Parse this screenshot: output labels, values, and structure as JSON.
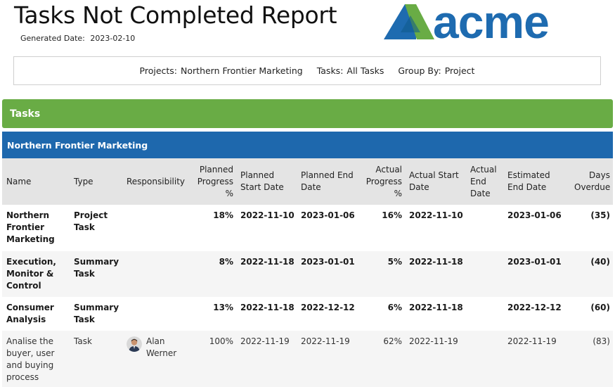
{
  "report": {
    "title": "Tasks Not Completed Report",
    "generated_label": "Generated Date:",
    "generated_value": "2023-02-10"
  },
  "logo": {
    "text": "acme",
    "colors": [
      "#1e6bb0",
      "#69ac45",
      "#0f5a8a"
    ]
  },
  "filters": {
    "projects_label": "Projects:",
    "projects_value": "Northern Frontier Marketing",
    "tasks_label": "Tasks:",
    "tasks_value": "All Tasks",
    "group_label": "Group By:",
    "group_value": "Project"
  },
  "section": {
    "title": "Tasks",
    "color": "#69ac45"
  },
  "group": {
    "title": "Northern Frontier Marketing",
    "color": "#1e68ad"
  },
  "columns": {
    "name": "Name",
    "type": "Type",
    "responsibility": "Responsibility",
    "planned_progress": "Planned Progress %",
    "planned_start": "Planned Start Date",
    "planned_end": "Planned End Date",
    "actual_progress": "Actual Progress %",
    "actual_start": "Actual Start Date",
    "actual_end": "Actual End Date",
    "estimated_end": "Estimated End Date",
    "days_overdue": "Days Overdue"
  },
  "rows": [
    {
      "name": "Northern Frontier Marketing",
      "type": "Project Task",
      "responsibility": "",
      "planned_progress": "18%",
      "planned_start": "2022-11-10",
      "planned_end": "2023-01-06",
      "actual_progress": "16%",
      "actual_start": "2022-11-10",
      "actual_end": "",
      "estimated_end": "2023-01-06",
      "days_overdue": "(35)"
    },
    {
      "name": "Execution, Monitor & Control",
      "type": "Summary Task",
      "responsibility": "",
      "planned_progress": "8%",
      "planned_start": "2022-11-18",
      "planned_end": "2023-01-01",
      "actual_progress": "5%",
      "actual_start": "2022-11-18",
      "actual_end": "",
      "estimated_end": "2023-01-01",
      "days_overdue": "(40)"
    },
    {
      "name": "Consumer Analysis",
      "type": "Summary Task",
      "responsibility": "",
      "planned_progress": "13%",
      "planned_start": "2022-11-18",
      "planned_end": "2022-12-12",
      "actual_progress": "6%",
      "actual_start": "2022-11-18",
      "actual_end": "",
      "estimated_end": "2022-12-12",
      "days_overdue": "(60)"
    },
    {
      "name": "Analise the buyer, user and buying process",
      "type": "Task",
      "responsibility": "Alan Werner",
      "planned_progress": "100%",
      "planned_start": "2022-11-19",
      "planned_end": "2022-11-19",
      "actual_progress": "62%",
      "actual_start": "2022-11-19",
      "actual_end": "",
      "estimated_end": "2022-11-19",
      "days_overdue": "(83)"
    }
  ]
}
